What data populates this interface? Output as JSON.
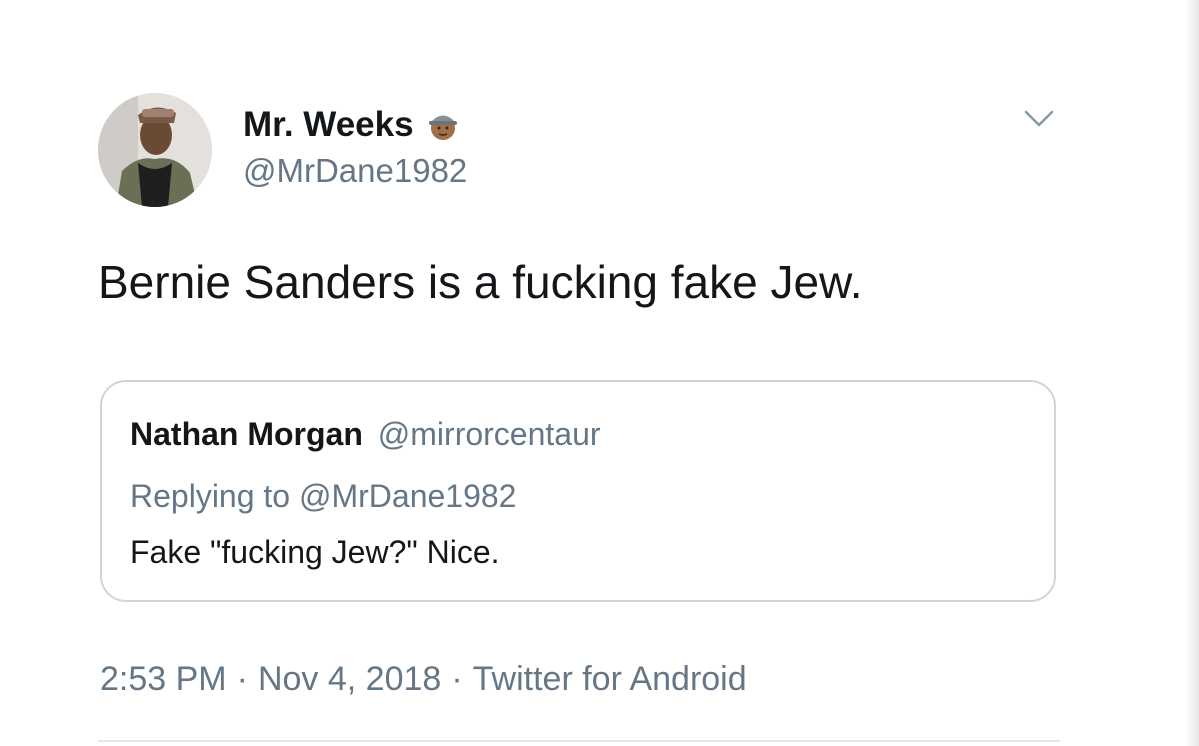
{
  "author": {
    "display_name": "Mr. Weeks",
    "name_emoji": "construction-worker-emoji",
    "handle": "@MrDane1982"
  },
  "tweet": {
    "text": "Bernie Sanders is a fucking fake Jew."
  },
  "quoted_tweet": {
    "display_name": "Nathan Morgan",
    "handle": "@mirrorcentaur",
    "reply_context": "Replying to @MrDane1982",
    "text": "Fake \"fucking Jew?\" Nice."
  },
  "meta": {
    "time": "2:53 PM",
    "separator": "·",
    "date": "Nov 4, 2018",
    "source": "Twitter for Android"
  },
  "icons": {
    "menu": "chevron-down-icon"
  },
  "colors": {
    "primary_text": "#14171a",
    "secondary_text": "#657786",
    "border": "#ccd6dd"
  }
}
